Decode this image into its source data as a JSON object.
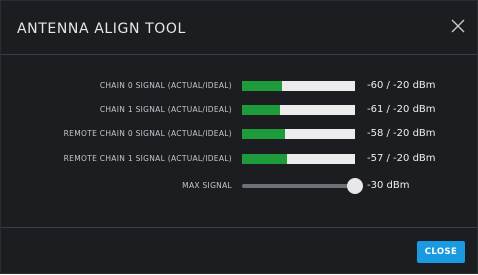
{
  "dialog": {
    "title": "ANTENNA ALIGN TOOL",
    "close_icon": "close-icon"
  },
  "signals": [
    {
      "label": "CHAIN 0 SIGNAL (ACTUAL/IDEAL)",
      "value": "-60 / -20 dBm",
      "fill_fraction": 0.35
    },
    {
      "label": "CHAIN 1 SIGNAL (ACTUAL/IDEAL)",
      "value": "-61 / -20 dBm",
      "fill_fraction": 0.34
    },
    {
      "label": "REMOTE CHAIN 0 SIGNAL (ACTUAL/IDEAL)",
      "value": "-58 / -20 dBm",
      "fill_fraction": 0.38
    },
    {
      "label": "REMOTE CHAIN 1 SIGNAL (ACTUAL/IDEAL)",
      "value": "-57 / -20 dBm",
      "fill_fraction": 0.4
    }
  ],
  "max_signal": {
    "label": "MAX SIGNAL",
    "value": "-30 dBm",
    "level_fraction": 1.0
  },
  "footer": {
    "close_label": "CLOSE"
  },
  "colors": {
    "background": "#1b1d21",
    "signal_fill": "#1e9b3a",
    "bar_track": "#ececec",
    "accent_button": "#1a9ae0"
  }
}
